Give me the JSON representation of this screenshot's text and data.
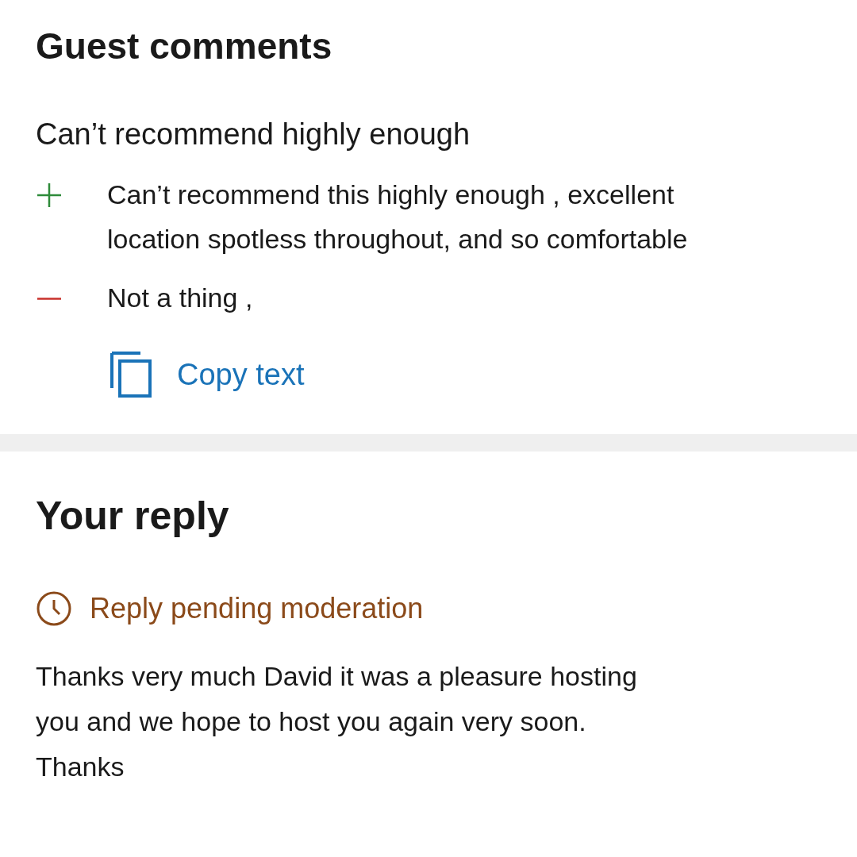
{
  "guest_comments": {
    "heading": "Guest comments",
    "title": "Can’t recommend highly enough",
    "points": [
      {
        "kind": "positive",
        "text": "Can’t recommend this highly enough , excellent location spotless throughout, and so comfortable"
      },
      {
        "kind": "negative",
        "text": "Not a thing ,"
      }
    ],
    "copy_button": "Copy text"
  },
  "your_reply": {
    "heading": "Your reply",
    "status": "Reply pending moderation",
    "text": "Thanks very much David it was a pleasure hosting you and we hope to host you again very soon. Thanks"
  }
}
